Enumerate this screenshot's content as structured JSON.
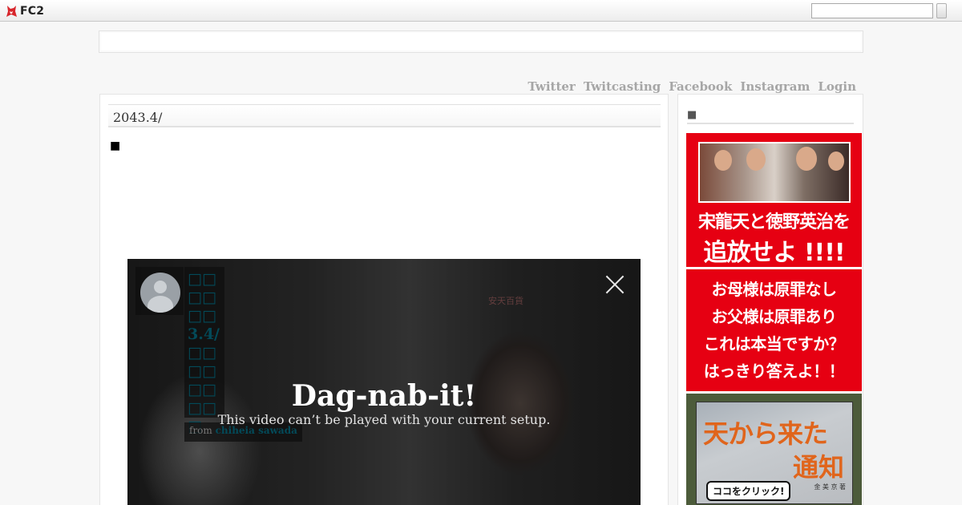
{
  "topbar": {
    "logo_text": "FC2",
    "search_value": "",
    "search_button_label": ""
  },
  "nav": {
    "links": [
      "Twitter",
      "Twitcasting",
      "Facebook",
      "Instagram",
      "Login"
    ]
  },
  "post": {
    "title": "2043.4/",
    "bullet": "■"
  },
  "sidebar": {
    "heading": "■",
    "banner1": {
      "line1": "宋龍天と徳野英治を",
      "line2": "追放せよ !!!!"
    },
    "banner2": {
      "lines": [
        "お母様は原罪なし",
        "お父様は原罪あり",
        "これは本当ですか？",
        "はっきり答えよ！！"
      ]
    },
    "banner3": {
      "title_top": "天から来た",
      "title_bottom": "通知",
      "author": "金 美 京 著",
      "cta": "ココをクリック!"
    }
  },
  "video": {
    "title_text": "□□□□□□3.4/□□□□□□□□□",
    "from_label": "from",
    "from_author": "chiheia sawada",
    "error_title": "Dag-nab-it!",
    "error_message": "This video can’t be played with your current setup.",
    "store_sign": "安天百貨"
  },
  "colors": {
    "banner_red": "#e60012",
    "nav_link": "#a6a6a6",
    "video_link": "#034a59"
  }
}
